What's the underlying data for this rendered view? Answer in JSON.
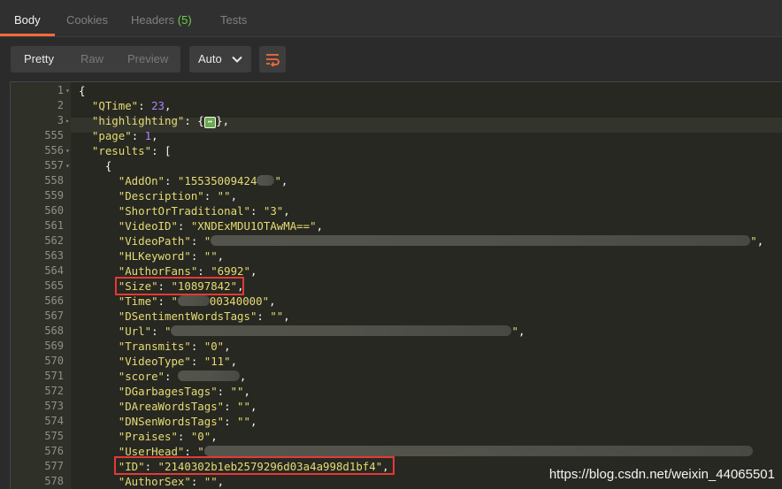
{
  "tabs": [
    {
      "label": "Body",
      "count": ""
    },
    {
      "label": "Cookies",
      "count": ""
    },
    {
      "label": "Headers",
      "count": "(5)"
    },
    {
      "label": "Tests",
      "count": ""
    }
  ],
  "toolbar": {
    "view_modes": [
      "Pretty",
      "Raw",
      "Preview"
    ],
    "format_selected": "Auto"
  },
  "editor": {
    "lines": [
      {
        "num": "1",
        "fold": true,
        "key": "",
        "value": "{",
        "type": "open"
      },
      {
        "num": "2",
        "fold": false,
        "key": "\"QTime\"",
        "value": "23",
        "type": "num"
      },
      {
        "num": "3",
        "fold": true,
        "key": "\"highlighting\"",
        "value": "{",
        "type": "collapsed"
      },
      {
        "num": "555",
        "fold": false,
        "key": "\"page\"",
        "value": "1",
        "type": "num"
      },
      {
        "num": "556",
        "fold": true,
        "key": "\"results\"",
        "value": "[",
        "type": "open"
      },
      {
        "num": "557",
        "fold": true,
        "key": "",
        "value": "{",
        "type": "open"
      },
      {
        "num": "558",
        "fold": false,
        "key": "\"AddOn\"",
        "value": "\"15535009424",
        "type": "blur-end"
      },
      {
        "num": "559",
        "fold": false,
        "key": "\"Description\"",
        "value": "\"\"",
        "type": "str"
      },
      {
        "num": "560",
        "fold": false,
        "key": "\"ShortOrTraditional\"",
        "value": "\"3\"",
        "type": "str"
      },
      {
        "num": "561",
        "fold": false,
        "key": "\"VideoID\"",
        "value": "\"XNDExMDU1OTAwMA==\"",
        "type": "str"
      },
      {
        "num": "562",
        "fold": false,
        "key": "\"VideoPath\"",
        "value": "\"",
        "type": "blur-long"
      },
      {
        "num": "563",
        "fold": false,
        "key": "\"HLKeyword\"",
        "value": "\"\"",
        "type": "str"
      },
      {
        "num": "564",
        "fold": false,
        "key": "\"AuthorFans\"",
        "value": "\"6992\"",
        "type": "str"
      },
      {
        "num": "565",
        "fold": false,
        "key": "\"Size\"",
        "value": "\"10897842\"",
        "type": "str"
      },
      {
        "num": "566",
        "fold": false,
        "key": "\"Time\"",
        "value": "\"",
        "type": "blur-time"
      },
      {
        "num": "567",
        "fold": false,
        "key": "\"DSentimentWordsTags\"",
        "value": "\"\"",
        "type": "str"
      },
      {
        "num": "568",
        "fold": false,
        "key": "\"Url\"",
        "value": "\"",
        "type": "blur-url"
      },
      {
        "num": "569",
        "fold": false,
        "key": "\"Transmits\"",
        "value": "\"0\"",
        "type": "str"
      },
      {
        "num": "570",
        "fold": false,
        "key": "\"VideoType\"",
        "value": "\"11\"",
        "type": "str"
      },
      {
        "num": "571",
        "fold": false,
        "key": "\"score\"",
        "value": "",
        "type": "blur-score"
      },
      {
        "num": "572",
        "fold": false,
        "key": "\"DGarbagesTags\"",
        "value": "\"\"",
        "type": "str"
      },
      {
        "num": "573",
        "fold": false,
        "key": "\"DAreaWordsTags\"",
        "value": "\"\"",
        "type": "str"
      },
      {
        "num": "574",
        "fold": false,
        "key": "\"DNSenWordsTags\"",
        "value": "\"\"",
        "type": "str"
      },
      {
        "num": "575",
        "fold": false,
        "key": "\"Praises\"",
        "value": "\"0\"",
        "type": "str"
      },
      {
        "num": "576",
        "fold": false,
        "key": "\"UserHead\"",
        "value": "\"",
        "type": "blur-head"
      },
      {
        "num": "577",
        "fold": false,
        "key": "\"ID\"",
        "value": "\"2140302b1eb2579296d03a4a998d1bf4\"",
        "type": "str"
      },
      {
        "num": "578",
        "fold": false,
        "key": "\"AuthorSex\"",
        "value": "\"\"",
        "type": "str"
      }
    ],
    "time_tail": "00340000\"",
    "watermark": "https://blog.csdn.net/weixin_44065501"
  },
  "colors": {
    "accent": "#f26b3a",
    "count_green": "#6ccf4b",
    "highlight_box": "#e53935"
  }
}
